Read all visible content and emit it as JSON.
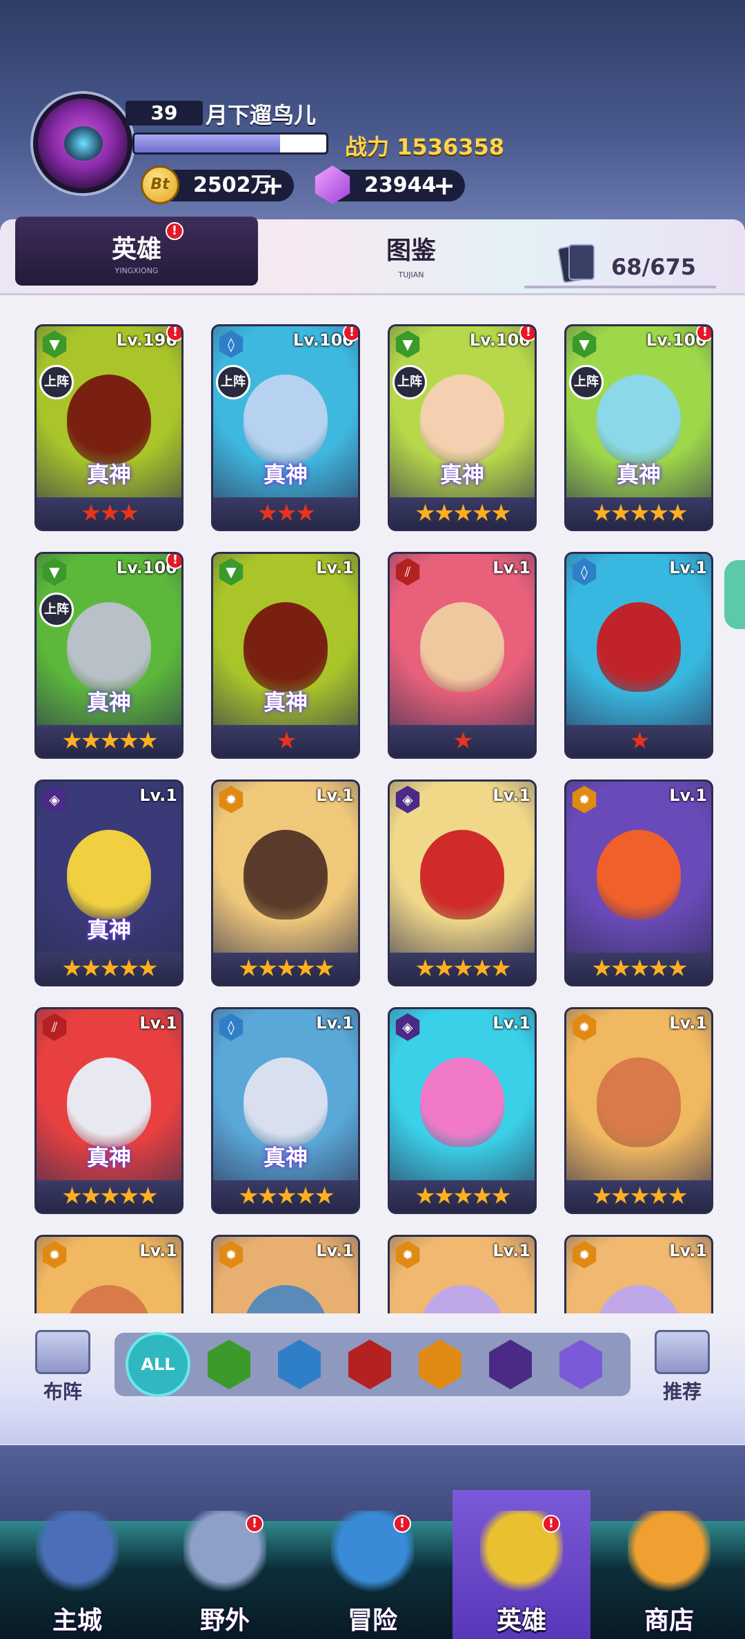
{
  "player": {
    "level": "39",
    "name": "月下遛鸟儿",
    "xp_progress": 0.76,
    "power_label": "战力",
    "power_value": "1536358",
    "gold": "2502万",
    "gems": "23944",
    "gold_icon_text": "Bt",
    "plus": "+"
  },
  "tabs": {
    "hero": {
      "label": "英雄",
      "sub": "YINGXIONG",
      "badge": "!"
    },
    "book": {
      "label": "图鉴",
      "sub": "TUJIAN"
    },
    "collection": "68/675"
  },
  "heroes": [
    {
      "level": "Lv.196",
      "element": "green",
      "deployed": true,
      "true_god": true,
      "stars": 3,
      "star_color": "red",
      "badge": true,
      "art": [
        "#a9c52a",
        "#7a2010"
      ]
    },
    {
      "level": "Lv.100",
      "element": "water",
      "deployed": true,
      "true_god": true,
      "stars": 3,
      "star_color": "red",
      "badge": true,
      "art": [
        "#3fb8e0",
        "#b7d2f0"
      ]
    },
    {
      "level": "Lv.100",
      "element": "green",
      "deployed": true,
      "true_god": true,
      "stars": 5,
      "star_color": "gold",
      "badge": true,
      "art": [
        "#b7d84a",
        "#f4d0b0"
      ]
    },
    {
      "level": "Lv.100",
      "element": "green",
      "deployed": true,
      "true_god": true,
      "stars": 5,
      "star_color": "gold",
      "badge": true,
      "art": [
        "#9ed84a",
        "#8ad8e8"
      ]
    },
    {
      "level": "Lv.100",
      "element": "green",
      "deployed": true,
      "true_god": true,
      "stars": 5,
      "star_color": "gold",
      "badge": true,
      "art": [
        "#5cb83a",
        "#b8c0c8"
      ]
    },
    {
      "level": "Lv.1",
      "element": "green",
      "deployed": false,
      "true_god": true,
      "stars": 1,
      "star_color": "red",
      "badge": false,
      "art": [
        "#a9c52a",
        "#7a2010"
      ]
    },
    {
      "level": "Lv.1",
      "element": "fire",
      "deployed": false,
      "true_god": false,
      "stars": 1,
      "star_color": "red",
      "badge": false,
      "art": [
        "#e8607a",
        "#f0c8a0"
      ]
    },
    {
      "level": "Lv.1",
      "element": "water",
      "deployed": false,
      "true_god": false,
      "stars": 1,
      "star_color": "red",
      "badge": false,
      "art": [
        "#38b8e0",
        "#c0242a"
      ]
    },
    {
      "level": "Lv.1",
      "element": "void",
      "deployed": false,
      "true_god": true,
      "stars": 5,
      "star_color": "gold",
      "badge": false,
      "art": [
        "#3a3a78",
        "#f0d040"
      ]
    },
    {
      "level": "Lv.1",
      "element": "sun",
      "deployed": false,
      "true_god": false,
      "stars": 5,
      "star_color": "gold",
      "badge": false,
      "art": [
        "#f0c87a",
        "#5a3a2a"
      ]
    },
    {
      "level": "Lv.1",
      "element": "void",
      "deployed": false,
      "true_god": false,
      "stars": 5,
      "star_color": "gold",
      "badge": false,
      "art": [
        "#f0d888",
        "#d02a2a"
      ]
    },
    {
      "level": "Lv.1",
      "element": "sun",
      "deployed": false,
      "true_god": false,
      "stars": 5,
      "star_color": "gold",
      "badge": false,
      "art": [
        "#6a4ab8",
        "#f0602a"
      ]
    },
    {
      "level": "Lv.1",
      "element": "fire",
      "deployed": false,
      "true_god": true,
      "stars": 5,
      "star_color": "gold",
      "badge": false,
      "art": [
        "#e84040",
        "#e8e8f0"
      ]
    },
    {
      "level": "Lv.1",
      "element": "water",
      "deployed": false,
      "true_god": true,
      "stars": 5,
      "star_color": "gold",
      "badge": false,
      "art": [
        "#5aa8d8",
        "#d8e0f0"
      ]
    },
    {
      "level": "Lv.1",
      "element": "void",
      "deployed": false,
      "true_god": false,
      "stars": 5,
      "star_color": "gold",
      "badge": false,
      "art": [
        "#3ad0e8",
        "#f07ac8"
      ]
    },
    {
      "level": "Lv.1",
      "element": "sun",
      "deployed": false,
      "true_god": false,
      "stars": 5,
      "star_color": "gold",
      "badge": false,
      "art": [
        "#f0b860",
        "#d87a4a"
      ]
    },
    {
      "level": "Lv.1",
      "element": "sun",
      "deployed": false,
      "true_god": false,
      "stars": 0,
      "star_color": "gold",
      "badge": false,
      "art": [
        "#f0b860",
        "#d87a4a"
      ]
    },
    {
      "level": "Lv.1",
      "element": "sun",
      "deployed": false,
      "true_god": false,
      "stars": 0,
      "star_color": "gold",
      "badge": false,
      "art": [
        "#e8b070",
        "#5a8ab8"
      ]
    },
    {
      "level": "Lv.1",
      "element": "sun",
      "deployed": false,
      "true_god": false,
      "stars": 0,
      "star_color": "gold",
      "badge": false,
      "art": [
        "#f0b870",
        "#c0a8e8"
      ]
    },
    {
      "level": "Lv.1",
      "element": "sun",
      "deployed": false,
      "true_god": false,
      "stars": 0,
      "star_color": "gold",
      "badge": false,
      "art": [
        "#f0b870",
        "#c0a8e8"
      ]
    }
  ],
  "card_labels": {
    "deploy": "上阵",
    "true_god": "真神",
    "badge": "!"
  },
  "filters": [
    {
      "name": "filter-all",
      "label": "ALL",
      "color": "#2fb8c0"
    },
    {
      "name": "filter-nature",
      "label": "",
      "color": "#3a9a2a"
    },
    {
      "name": "filter-water",
      "label": "",
      "color": "#2f7fc8"
    },
    {
      "name": "filter-fire",
      "label": "",
      "color": "#b52020"
    },
    {
      "name": "filter-sun",
      "label": "",
      "color": "#e08a14"
    },
    {
      "name": "filter-void",
      "label": "",
      "color": "#4a2a86"
    },
    {
      "name": "filter-spirit",
      "label": "",
      "color": "#7a5ad8"
    }
  ],
  "formation_label": "布阵",
  "recommend_label": "推荐",
  "nav": [
    {
      "label": "主城",
      "badge": false,
      "active": false,
      "color": "#4a6fb8"
    },
    {
      "label": "野外",
      "badge": true,
      "active": false,
      "color": "#8ea0c8"
    },
    {
      "label": "冒险",
      "badge": true,
      "active": false,
      "color": "#3a8ad8"
    },
    {
      "label": "英雄",
      "badge": true,
      "active": true,
      "color": "#e8c030"
    },
    {
      "label": "商店",
      "badge": false,
      "active": false,
      "color": "#f0a030"
    }
  ],
  "element_icons": {
    "green": "▼",
    "water": "◊",
    "fire": "⫽",
    "sun": "✹",
    "void": "◈"
  }
}
